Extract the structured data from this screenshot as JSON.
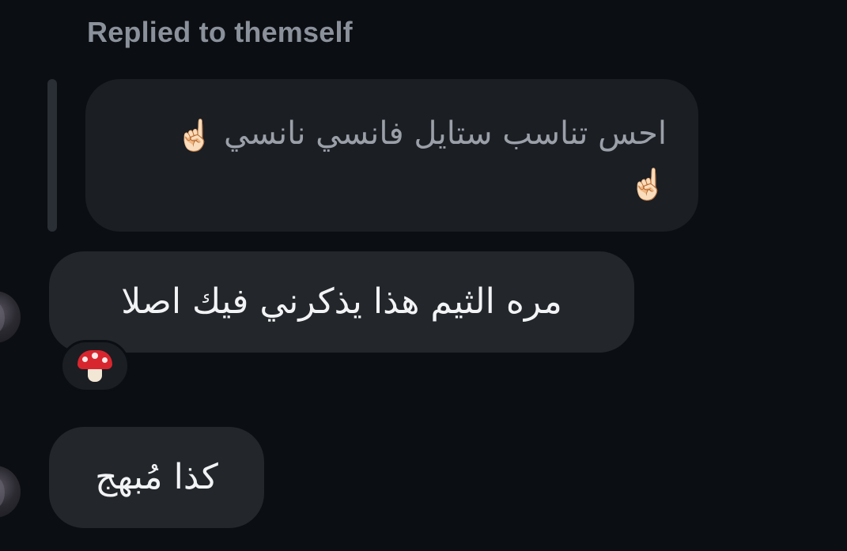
{
  "reply_context": {
    "label": "Replied to themself",
    "quoted_message": {
      "text": "احس تناسب ستايل فانسي نانسي",
      "emoji_1": "☝🏻",
      "emoji_2": "☝🏻"
    }
  },
  "messages": [
    {
      "text": "مره الثيم هذا يذكرني فيك اصلا",
      "reaction_icon": "mushroom-icon"
    },
    {
      "text": "كذا مُبهج"
    }
  ],
  "colors": {
    "background": "#0b0e12",
    "bubble": "#23262b",
    "quoted_bubble": "#1b1e23",
    "muted_text": "#8b919a",
    "message_text": "#f2f3f5"
  }
}
